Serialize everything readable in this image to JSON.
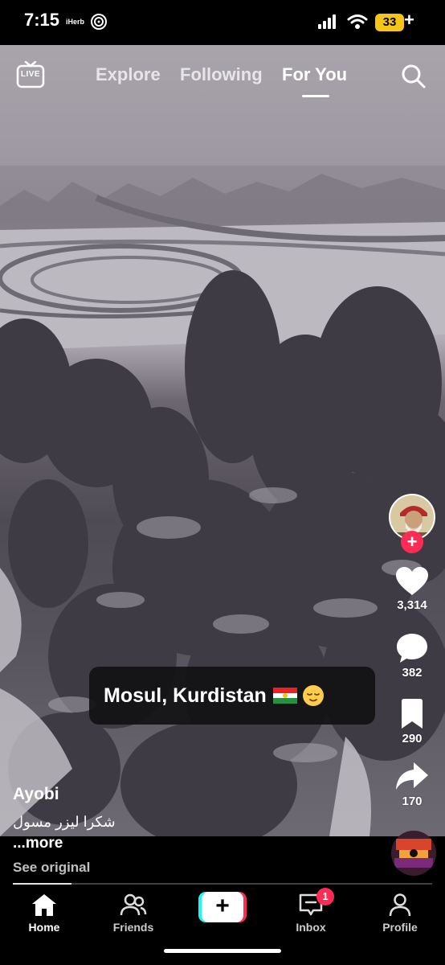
{
  "status_bar": {
    "time": "7:15",
    "app_label": "iHerb",
    "battery": "33",
    "battery_plus": "+",
    "battery_color": "#f5c518"
  },
  "top_nav": {
    "live_label": "LIVE",
    "tabs": [
      {
        "label": "Explore",
        "active": false
      },
      {
        "label": "Following",
        "active": false
      },
      {
        "label": "For You",
        "active": true
      }
    ],
    "search_icon": "search-icon"
  },
  "video": {
    "caption": "Mosul, Kurdistan",
    "caption_emojis": [
      "kurdistan-flag-icon",
      "relieved-face-icon"
    ]
  },
  "actions": {
    "follow_icon": "plus-icon",
    "likes": "3,314",
    "comments": "382",
    "saves": "290",
    "shares": "170"
  },
  "post": {
    "author": "Ayobi",
    "description": "شكرا ليزر مسول",
    "more_label": "...more",
    "see_original_label": "See original",
    "progress": 0.14
  },
  "bottom_nav": {
    "items": [
      {
        "label": "Home",
        "icon": "home-icon",
        "active": true
      },
      {
        "label": "Friends",
        "icon": "friends-icon",
        "active": false
      },
      {
        "label": "+",
        "icon": "create-icon",
        "active": false
      },
      {
        "label": "Inbox",
        "icon": "inbox-icon",
        "active": false
      },
      {
        "label": "Profile",
        "icon": "profile-icon",
        "active": false
      }
    ],
    "inbox_badge": "1"
  },
  "colors": {
    "accent_red": "#fe2c55",
    "accent_cyan": "#25f4ee"
  }
}
